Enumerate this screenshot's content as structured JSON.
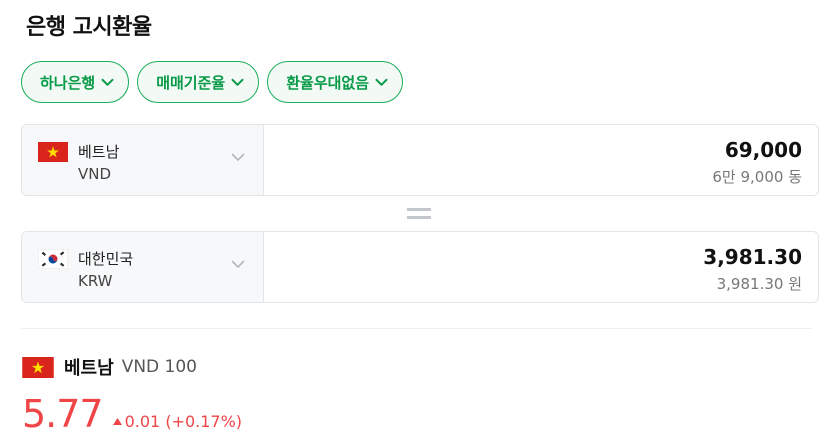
{
  "title": "은행 고시환율",
  "filters": [
    {
      "label": "하나은행"
    },
    {
      "label": "매매기준율"
    },
    {
      "label": "환율우대없음"
    }
  ],
  "converter": {
    "from": {
      "name": "베트남",
      "code": "VND",
      "amount": "69,000",
      "amount_text": "6만 9,000 동",
      "flag": "vietnam-flag-icon"
    },
    "to": {
      "name": "대한민국",
      "code": "KRW",
      "amount": "3,981.30",
      "amount_text": "3,981.30 원",
      "flag": "korea-flag-icon"
    }
  },
  "rate": {
    "country": "베트남",
    "unit": "VND 100",
    "value": "5.77",
    "change": "0.01 (+0.17%)",
    "direction": "up",
    "color": "#f04547"
  },
  "colors": {
    "accent": "#19ae5a",
    "accent_text": "#079a47",
    "rise": "#f04547"
  }
}
